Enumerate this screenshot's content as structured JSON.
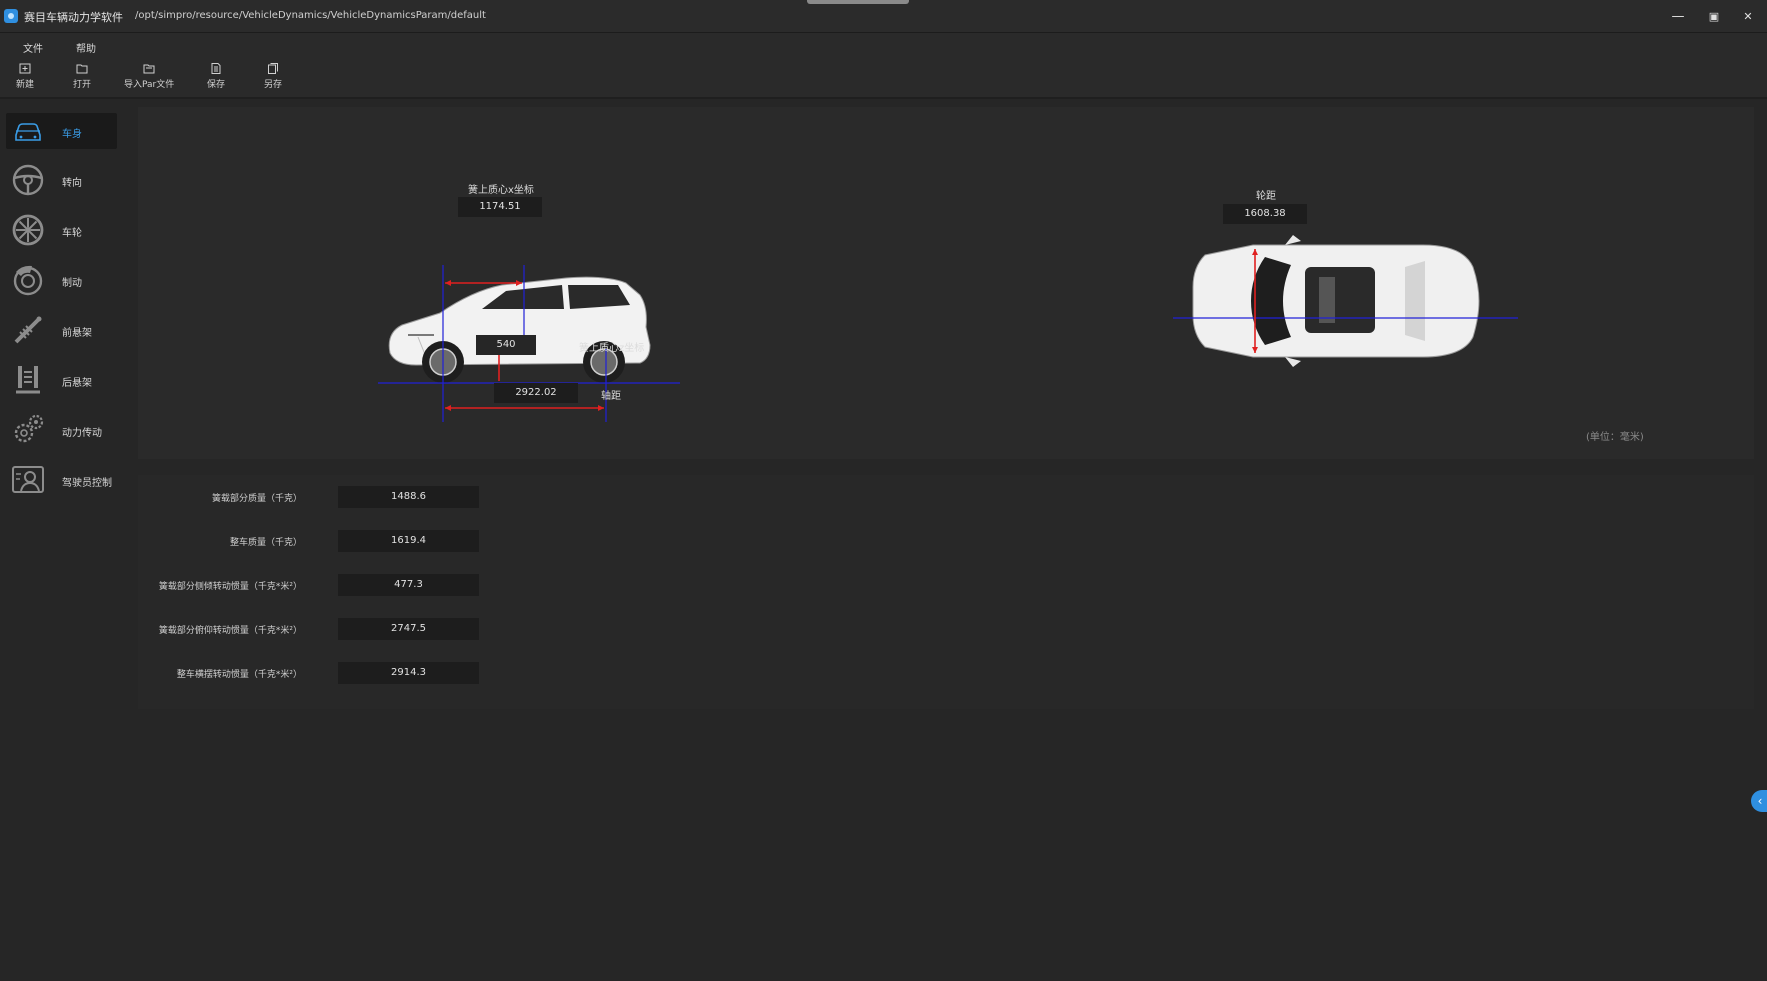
{
  "titlebar": {
    "app_title": "赛目车辆动力学软件",
    "file_path": "/opt/simpro/resource/VehicleDynamics/VehicleDynamicsParam/default",
    "minimize_glyph": "—",
    "maximize_glyph": "▣",
    "close_glyph": "✕"
  },
  "menu": {
    "file": "文件",
    "help": "帮助"
  },
  "toolbar": {
    "new": "新建",
    "open": "打开",
    "import_par": "导入Par文件",
    "save": "保存",
    "save_as": "另存"
  },
  "sidebar": {
    "items": [
      {
        "label": "车身",
        "icon": "car-body-icon"
      },
      {
        "label": "转向",
        "icon": "steering-wheel-icon"
      },
      {
        "label": "车轮",
        "icon": "wheel-icon"
      },
      {
        "label": "制动",
        "icon": "brake-disc-icon"
      },
      {
        "label": "前悬架",
        "icon": "front-suspension-icon"
      },
      {
        "label": "后悬架",
        "icon": "rear-suspension-icon"
      },
      {
        "label": "动力传动",
        "icon": "gears-icon"
      },
      {
        "label": "驾驶员控制",
        "icon": "driver-icon"
      }
    ],
    "active_index": 0
  },
  "diagram": {
    "cg_x_label": "簧上质心x坐标",
    "cg_x_value": "1174.51",
    "cg_z_label": "簧上质心z坐标",
    "cg_z_value": "540",
    "wheelbase_label": "轴距",
    "wheelbase_value": "2922.02",
    "track_label": "轮距",
    "track_value": "1608.38",
    "unit_note": "(单位：毫米)"
  },
  "params": [
    {
      "label": "簧载部分质量（千克）",
      "value": "1488.6"
    },
    {
      "label": "整车质量（千克）",
      "value": "1619.4"
    },
    {
      "label": "簧载部分侧倾转动惯量（千克*米²）",
      "value": "477.3"
    },
    {
      "label": "簧载部分俯仰转动惯量（千克*米²）",
      "value": "2747.5"
    },
    {
      "label": "整车横摆转动惯量（千克*米²）",
      "value": "2914.3"
    }
  ],
  "colors": {
    "accent": "#2f8fe0",
    "dim_blue": "#2020d8",
    "dim_red": "#e02020",
    "panel": "#2a2a2a",
    "input": "#1d1d1d"
  }
}
